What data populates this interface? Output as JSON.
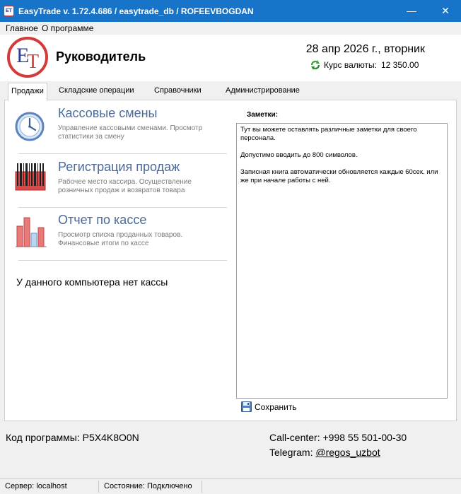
{
  "window": {
    "title": "EasyTrade v. 1.72.4.686 / easytrade_db / ROFEEVBOGDAN",
    "app_icon_text": "ET",
    "minimize_symbol": "—",
    "close_symbol": "✕"
  },
  "menu": {
    "items": [
      "Главное",
      "О программе"
    ]
  },
  "header": {
    "logo_e": "E",
    "logo_t": "T",
    "role": "Руководитель",
    "date": "28 апр 2026 г., вторник",
    "currency_label": "Курс валюты:",
    "currency_value": "12 350.00"
  },
  "tabs": [
    "Продажи",
    "Складские операции",
    "Справочники",
    "Администрирование"
  ],
  "active_tab": "Продажи",
  "sales": {
    "items": [
      {
        "title": "Кассовые смены",
        "desc": "Управление кассовыми сменами. Просмотр статистики за смену",
        "icon": "clock-icon"
      },
      {
        "title": "Регистрация продаж",
        "desc": "Рабочее место кассира. Осуществление розничных продаж и возвратов товара",
        "icon": "barcode-icon"
      },
      {
        "title": "Отчет по кассе",
        "desc": "Просмотр списка проданных товаров. Финансовые  итоги по кассе",
        "icon": "bar-chart-icon"
      }
    ],
    "no_cash_message": "У данного компьютера нет кассы"
  },
  "notes": {
    "label": "Заметки:",
    "lines": [
      "Тут вы можете оставлять различные заметки для своего персонала.",
      "Допустимо вводить до 800 символов.",
      "Записная книга автоматически обновляется каждые 60сек. или же при начале работы с ней."
    ],
    "save_label": "Сохранить"
  },
  "footer": {
    "program_code_label": "Код программы:",
    "program_code": "P5X4K8O0N",
    "callcenter_label": "Call-center:",
    "callcenter": "+998 55 501-00-30",
    "telegram_label": "Telegram:",
    "telegram": "@regos_uzbot"
  },
  "status": {
    "server_label": "Сервер:",
    "server": "localhost",
    "state_label": "Состояние:",
    "state": "Подключено"
  },
  "colors": {
    "titlebar": "#1874c8",
    "link_title": "#4a6a9a",
    "logo_red": "#d33a3a",
    "logo_blue": "#2b3d8f"
  }
}
